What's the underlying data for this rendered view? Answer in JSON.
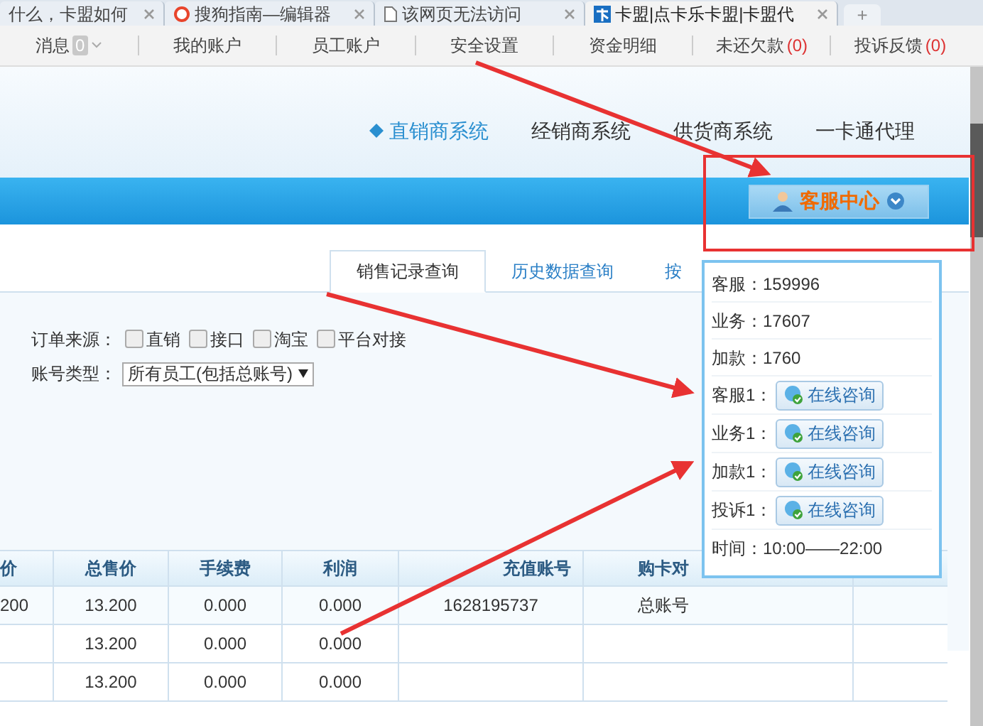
{
  "browser_tabs": [
    {
      "label": "什么，卡盟如何",
      "selected": false,
      "kind": "plain"
    },
    {
      "label": "搜狗指南—编辑器",
      "selected": false,
      "kind": "sogou"
    },
    {
      "label": "该网页无法访问",
      "selected": false,
      "kind": "page"
    },
    {
      "label": "卡盟|点卡乐卡盟|卡盟代",
      "selected": true,
      "kind": "site"
    }
  ],
  "new_tab": "+",
  "toolbar": [
    {
      "label": "消息",
      "badge": "0"
    },
    {
      "label": "我的账户"
    },
    {
      "label": "员工账户"
    },
    {
      "label": "安全设置"
    },
    {
      "label": "资金明细"
    },
    {
      "label": "未还欠款",
      "count": "(0)"
    },
    {
      "label": "投诉反馈",
      "count": "(0)"
    }
  ],
  "nav": [
    {
      "label": "直销商系统",
      "selected": true
    },
    {
      "label": "经销商系统",
      "selected": false
    },
    {
      "label": "供货商系统",
      "selected": false
    },
    {
      "label": "一卡通代理",
      "selected": false
    }
  ],
  "service_button": "客服中心",
  "content_tabs": [
    {
      "label": "销售记录查询",
      "selected": true
    },
    {
      "label": "历史数据查询",
      "selected": false
    },
    {
      "label": "按",
      "selected": false
    }
  ],
  "order_source": {
    "label": "订单来源：",
    "options": [
      {
        "label": "直销",
        "checked": false
      },
      {
        "label": "接口",
        "checked": false
      },
      {
        "label": "淘宝",
        "checked": false
      },
      {
        "label": "平台对接",
        "checked": false
      }
    ]
  },
  "account_type": {
    "label": "账号类型：",
    "value": "所有员工(包括总账号)"
  },
  "table": {
    "columns": [
      "价",
      "总售价",
      "手续费",
      "利润",
      "充值账号",
      "购卡对"
    ],
    "rows": [
      [
        "200",
        "13.200",
        "0.000",
        "0.000",
        "1628195737",
        "总账号"
      ],
      [
        "",
        "13.200",
        "0.000",
        "0.000",
        "",
        ""
      ],
      [
        "",
        "13.200",
        "0.000",
        "0.000",
        "",
        ""
      ]
    ]
  },
  "service_popup": {
    "contacts": [
      {
        "label": "客服：",
        "value": "159996"
      },
      {
        "label": "业务：",
        "value": "17607"
      },
      {
        "label": "加款：",
        "value": "1760"
      }
    ],
    "consult": [
      {
        "label": "客服1：",
        "button": "在线咨询"
      },
      {
        "label": "业务1：",
        "button": "在线咨询"
      },
      {
        "label": "加款1：",
        "button": "在线咨询"
      },
      {
        "label": "投诉1：",
        "button": "在线咨询"
      }
    ],
    "hours": "时间：10:00——22:00"
  }
}
